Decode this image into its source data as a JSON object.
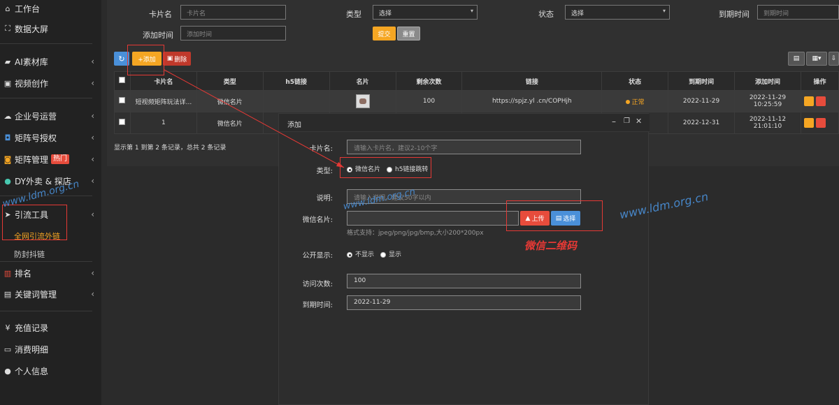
{
  "sidebar": {
    "items": [
      {
        "icon": "home-icon",
        "glyph": "⌂",
        "label": "工作台"
      },
      {
        "icon": "chart-line-icon",
        "glyph": "⛶",
        "label": "数据大屏"
      },
      {
        "icon": "folder-icon",
        "glyph": "▰",
        "label": "AI素材库"
      },
      {
        "icon": "film-icon",
        "glyph": "▣",
        "label": "视频创作"
      },
      {
        "icon": "cloud-icon",
        "glyph": "☁",
        "label": "企业号运营"
      },
      {
        "icon": "matrix-auth-icon",
        "glyph": "◘",
        "label": "矩阵号授权"
      },
      {
        "icon": "matrix-manage-icon",
        "glyph": "◙",
        "label": "矩阵管理",
        "badge": "热门"
      },
      {
        "icon": "globe-icon",
        "glyph": "●",
        "label": "DY外卖 & 探店"
      },
      {
        "icon": "send-icon",
        "glyph": "➤",
        "label": "引流工具"
      },
      {
        "icon": "rank-icon",
        "glyph": "▥",
        "label": "排名"
      },
      {
        "icon": "document-icon",
        "glyph": "▤",
        "label": "关键词管理"
      },
      {
        "icon": "yen-icon",
        "glyph": "¥",
        "label": "充值记录"
      },
      {
        "icon": "money-icon",
        "glyph": "▭",
        "label": "消费明细"
      },
      {
        "icon": "user-icon",
        "glyph": "●",
        "label": "个人信息"
      }
    ],
    "sub_items": [
      "全网引流外链",
      "防封抖链"
    ]
  },
  "filters": {
    "card_name_label": "卡片名",
    "card_name_placeholder": "卡片名",
    "type_label": "类型",
    "type_value": "选择",
    "status_label": "状态",
    "status_value": "选择",
    "expire_label": "到期时间",
    "expire_placeholder": "到期时间",
    "add_time_label": "添加时间",
    "add_time_placeholder": "添加时间",
    "submit": "提交",
    "reset": "重置"
  },
  "toolbar": {
    "refresh_glyph": "↻",
    "add_label": "+添加",
    "delete_label": "删除"
  },
  "table": {
    "headers": [
      "卡片名",
      "类型",
      "h5链接",
      "名片",
      "剩余次数",
      "链接",
      "状态",
      "到期时间",
      "添加时间",
      "操作"
    ],
    "rows": [
      {
        "name": "短视频矩阵玩法详...",
        "type": "微信名片",
        "h5": "",
        "count": "100",
        "link": "https://spjz.yl        .cn/COPHjh",
        "status": "正常",
        "expire": "2022-11-29",
        "added": "2022-11-29 10:25:59"
      },
      {
        "name": "1",
        "type": "微信名片",
        "h5": "",
        "count": "",
        "link": "",
        "status": "",
        "expire": "2022-12-31",
        "added": "2022-11-12 21:01:10"
      }
    ],
    "footer": "显示第 1 到第 2 条记录，总共 2 条记录"
  },
  "modal": {
    "title": "添加",
    "card_name_label": "卡片名:",
    "card_name_placeholder": "请输入卡片名，建议2-10个字",
    "type_label": "类型:",
    "type_opt1": "微信名片",
    "type_opt2": "h5链接跳转",
    "desc_label": "说明:",
    "desc_placeholder": "请输入说明，建议50字以内",
    "wechat_label": "微信名片:",
    "upload": "上传",
    "choose": "选择",
    "format_hint": "格式支持：jpeg/png/jpg/bmp,大小200*200px",
    "public_label": "公开显示:",
    "public_opt1": "不显示",
    "public_opt2": "显示",
    "visits_label": "访问次数:",
    "visits_value": "100",
    "expire_label": "到期时间:",
    "expire_value": "2022-11-29"
  },
  "annotation": {
    "label": "微信二维码"
  },
  "watermark": "www.ldm.org.cn",
  "colors": {
    "accent": "#f5a623",
    "danger": "#e74c3c",
    "primary": "#4a90d9"
  }
}
